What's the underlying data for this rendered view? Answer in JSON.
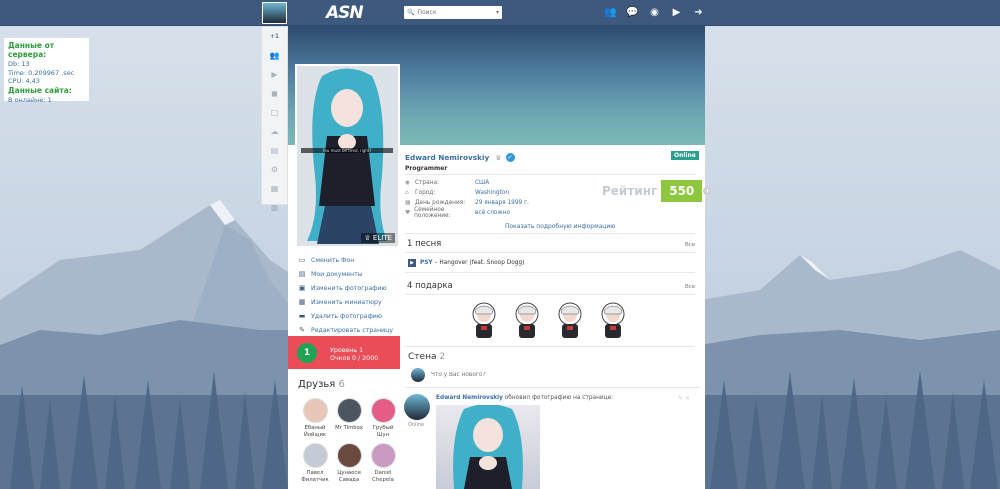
{
  "topbar": {
    "logo": "ASN",
    "search_placeholder": "Поиск",
    "icons": [
      "friends-icon",
      "messages-icon",
      "games-icon",
      "video-icon",
      "logout-icon"
    ]
  },
  "side_menu": {
    "badge": "+1",
    "items": [
      "people-icon",
      "video-icon",
      "camera-icon",
      "document-icon",
      "cloud-icon",
      "news-icon",
      "settings-icon",
      "apps-icon",
      "groups-icon"
    ]
  },
  "server": {
    "title": "Данные от сервера:",
    "db": "Db: 13",
    "time": "Time: 0,209967 .sec",
    "cpu": "CPU: 4,43",
    "site_title": "Данные сайта:",
    "online": "В онлайне: 1"
  },
  "profile": {
    "elite": "ELITE",
    "photo_caption": "You must be tired, right?",
    "name": "Edward  Nemirovskiy",
    "online": "Online",
    "status": "Programmer",
    "info": [
      {
        "key": "Страна:",
        "value": "США",
        "icon": "globe-icon"
      },
      {
        "key": "Город:",
        "value": "Washington",
        "icon": "home-icon"
      },
      {
        "key": "День рождения:",
        "value": "29 января 1999 г.",
        "icon": "calendar-icon"
      },
      {
        "key": "Семейное положение:",
        "value": "всё сложно",
        "icon": "heart-icon"
      }
    ],
    "rating_label": "Рейтинг",
    "rating_value": "550",
    "more_info": "Показать подробную информацию"
  },
  "actions": [
    {
      "label": "Сменить Фон",
      "icon": "monitor-icon"
    },
    {
      "label": "Мои документы",
      "icon": "documents-icon"
    },
    {
      "label": "Изменить фотографию",
      "icon": "photo-icon"
    },
    {
      "label": "Изменить миниатюру",
      "icon": "thumbnail-icon"
    },
    {
      "label": "Удалить фотографию",
      "icon": "delete-icon"
    },
    {
      "label": "Редактировать страницу",
      "icon": "pencil-icon"
    }
  ],
  "level": {
    "badge": "1",
    "line1": "Уровень 1",
    "line2": "Очков 0 / 2000"
  },
  "friends": {
    "title": "Друзья",
    "count": "6",
    "list": [
      {
        "name": "Ебаный Йойщик",
        "color": "#e8c7b8"
      },
      {
        "name": "Mr Timbox",
        "color": "#4d5560"
      },
      {
        "name": "Грубый Шун",
        "color": "#e35d86"
      },
      {
        "name": "Павел Филатчик",
        "color": "#c4cbd4"
      },
      {
        "name": "Цунаеси Савада",
        "color": "#6a4a3e"
      },
      {
        "name": "Daniel Chepela",
        "color": "#c99ac4"
      }
    ]
  },
  "songs": {
    "title": "1 песня",
    "all": "Все",
    "artist": "PSY",
    "track": "– Hangover (feat. Snoop Dogg)"
  },
  "gifts": {
    "title": "4 подарка",
    "all": "Все",
    "count": 4
  },
  "wall": {
    "title": "Стена",
    "count": "2",
    "placeholder": "Что у Вас нового?",
    "post": {
      "author": "Edward Nemirovskiy",
      "text": "обновил фотографию на странице:",
      "online": "Online"
    }
  }
}
